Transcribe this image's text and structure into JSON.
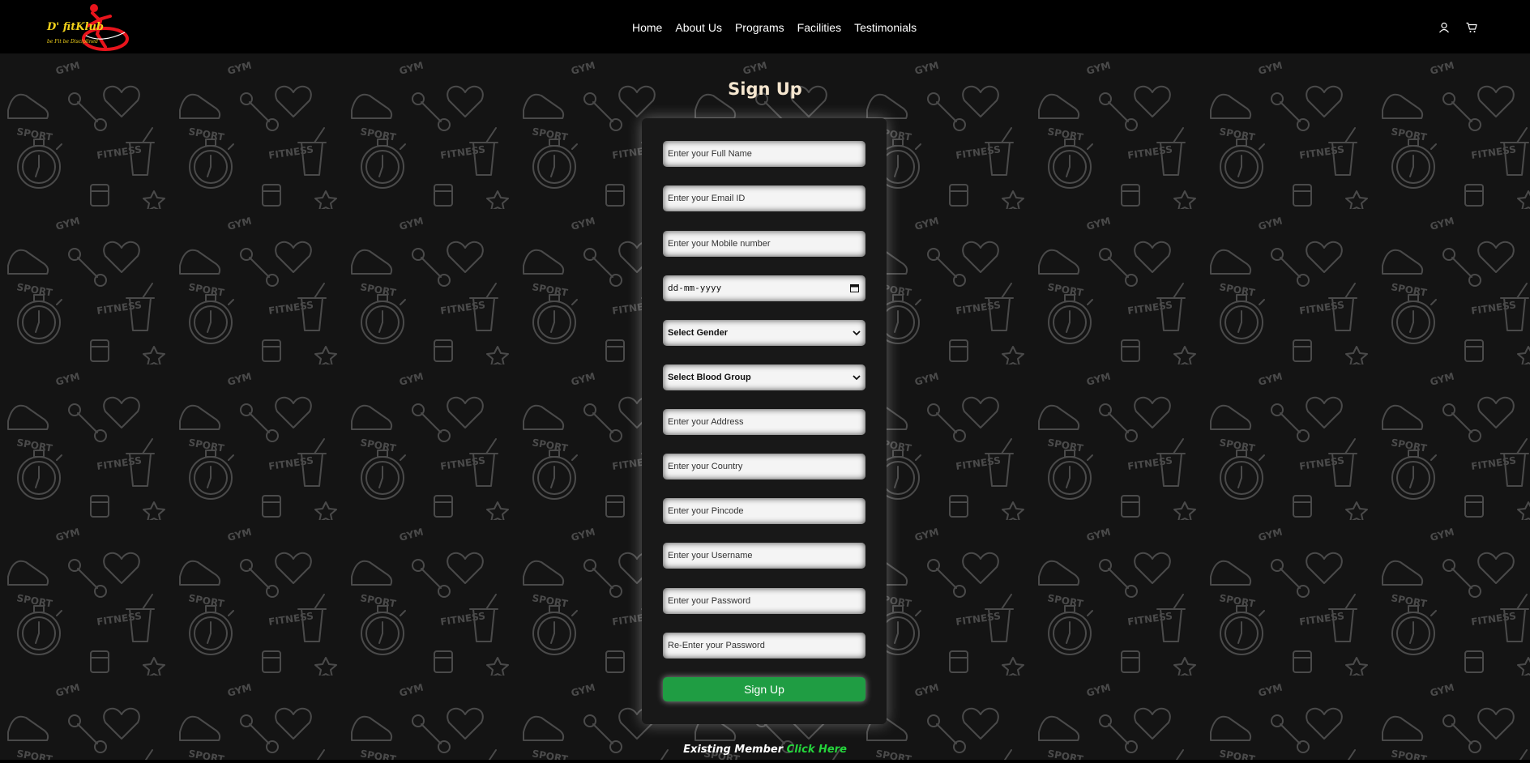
{
  "brand": {
    "name": "D' fitKlub",
    "tagline": "be Fit be Disciplined"
  },
  "nav": {
    "items": [
      "Home",
      "About Us",
      "Programs",
      "Facilities",
      "Testimonials"
    ]
  },
  "header_icons": [
    "user-icon",
    "cart-icon"
  ],
  "page": {
    "title": "Sign Up"
  },
  "form": {
    "full_name_placeholder": "Enter your Full Name",
    "email_placeholder": "Enter your Email ID",
    "mobile_placeholder": "Enter your Mobile number",
    "dob_placeholder": "dd-mm-yyyy",
    "gender_selected": "Select Gender",
    "blood_group_selected": "Select Blood Group",
    "address_placeholder": "Enter your Address",
    "country_placeholder": "Enter your Country",
    "pincode_placeholder": "Enter your Pincode",
    "username_placeholder": "Enter your Username",
    "password_placeholder": "Enter your Password",
    "reenter_password_placeholder": "Re-Enter your Password",
    "submit_label": "Sign Up"
  },
  "footer": {
    "existing_text": "Existing Member",
    "link_text": "Click Here"
  },
  "colors": {
    "header_bg": "#000000",
    "page_bg": "#141414",
    "title": "#f5e6cf",
    "button": "#1f9d43",
    "link": "#25d43c",
    "brand": "#f2d21b",
    "logo_red": "#e8141c"
  }
}
